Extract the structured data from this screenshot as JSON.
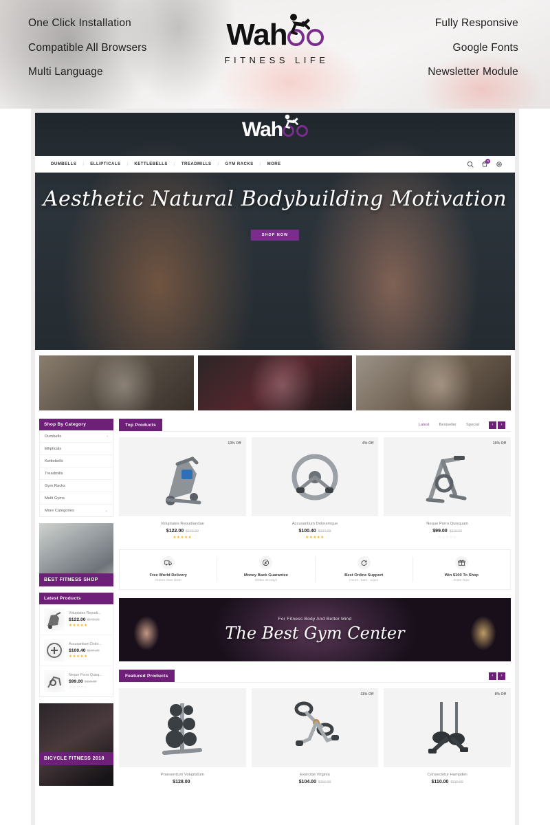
{
  "promo": {
    "features_left": [
      "One Click Installation",
      "Compatible All Browsers",
      "Multi Language"
    ],
    "features_right": [
      "Fully Responsive",
      "Google Fonts",
      "Newsletter Module"
    ],
    "logo_name": "Wah",
    "logo_tagline": "FITNESS LIFE"
  },
  "accent_color": "#6e1f77",
  "site": {
    "logo_name": "Wah",
    "logo_tagline": "FITNESS LIFE",
    "nav": [
      "DUMBELLS",
      "ELLIPTICALS",
      "KETTLEBELLS",
      "TREADMILLS",
      "GYM RACKS",
      "MORE"
    ],
    "nav_icons": [
      "search-icon",
      "cart-icon",
      "settings-icon"
    ],
    "cart_count": "0",
    "hero": {
      "title": "Aesthetic Natural Bodybuilding Motivation",
      "button": "SHOP NOW"
    },
    "sidebar": {
      "category_title": "Shop By Category",
      "categories": [
        {
          "label": "Dumbells",
          "chevron": "›"
        },
        {
          "label": "Ellipticals",
          "chevron": ""
        },
        {
          "label": "Kettlebells",
          "chevron": ""
        },
        {
          "label": "Treadmills",
          "chevron": ""
        },
        {
          "label": "Gym Racks",
          "chevron": ""
        },
        {
          "label": "Multi Gyms",
          "chevron": ""
        },
        {
          "label": "More Categories",
          "chevron": "⌄"
        }
      ],
      "banner_1_caption": "BEST FITNESS SHOP",
      "banner_2_caption": "BICYCLE FITNESS 2018",
      "latest_title": "Latest Products",
      "latest_products": [
        {
          "name": "Voluptates Repudi...",
          "price": "$122.00",
          "old_price": "$140.00",
          "rating": 5
        },
        {
          "name": "Accusantium Dolor...",
          "price": "$100.40",
          "old_price": "$104.00",
          "rating": 5
        },
        {
          "name": "Neque Porro Quisq...",
          "price": "$99.00",
          "old_price": "$118.00",
          "rating": 0
        }
      ]
    },
    "top_products": {
      "title": "Top Products",
      "tabs": [
        "Latest",
        "Bestseller",
        "Special"
      ],
      "active_tab": "Latest",
      "prev_label": "‹",
      "next_label": "›",
      "items": [
        {
          "name": "Voluptates Repudiandae",
          "price": "$122.00",
          "old_price": "$140.00",
          "badge": "13% Off",
          "rating": 5,
          "icon": "elliptical-trainer"
        },
        {
          "name": "Accusantium Doloremque",
          "price": "$100.40",
          "old_price": "$104.00",
          "badge": "4% Off",
          "rating": 5,
          "icon": "exercise-wheel"
        },
        {
          "name": "Neque Porro Quisquam",
          "price": "$99.00",
          "old_price": "$118.00",
          "badge": "16% Off",
          "rating": 0,
          "icon": "spin-bike"
        }
      ]
    },
    "services": [
      {
        "title": "Free World Delivery",
        "subtitle": "Orders Over $100",
        "icon": "delivery-truck-icon"
      },
      {
        "title": "Money Back Guarantee",
        "subtitle": "Within 30 Days",
        "icon": "money-back-icon"
      },
      {
        "title": "Best Online Support",
        "subtitle": "Hours : 8am - 11pm",
        "icon": "support-refresh-icon"
      },
      {
        "title": "Win $100 To Shop",
        "subtitle": "Enter Now",
        "icon": "gift-icon"
      }
    ],
    "gym_banner": {
      "subtitle": "For Fitness Body And Better Mind",
      "title": "The Best Gym Center"
    },
    "featured_products": {
      "title": "Featured Products",
      "prev_label": "‹",
      "next_label": "›",
      "items": [
        {
          "name": "Praesentium Voluptatum",
          "price": "$128.00",
          "old_price": "",
          "badge": "",
          "icon": "weight-plate-tree"
        },
        {
          "name": "Exercitat Virginia",
          "price": "$104.00",
          "old_price": "$116.00",
          "badge": "11% Off",
          "icon": "pedal-exerciser"
        },
        {
          "name": "Consectetur Hampden",
          "price": "$110.00",
          "old_price": "$119.60",
          "badge": "8% Off",
          "icon": "weight-sled"
        }
      ]
    }
  }
}
